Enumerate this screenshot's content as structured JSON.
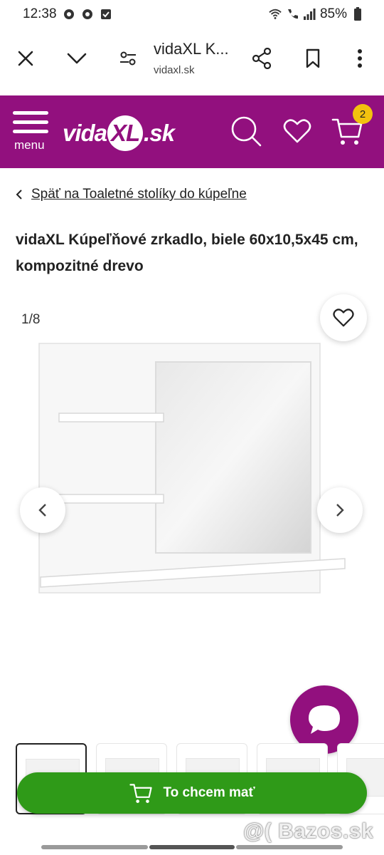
{
  "status_bar": {
    "time": "12:38",
    "battery": "85%"
  },
  "browser": {
    "title": "vidaXL K...",
    "url": "vidaxl.sk"
  },
  "header": {
    "menu_label": "menu",
    "logo_left": "vida",
    "logo_mid": "XL",
    "logo_right": ".sk",
    "cart_count": "2",
    "brand_color": "#92107e",
    "badge_color": "#f2c20f"
  },
  "breadcrumb": {
    "back_label": "Späť na Toaletné stolíky do kúpeľne"
  },
  "product": {
    "title": "vidaXL Kúpeľňové zrkadlo, biele 60x10,5x45 cm, kompozitné drevo",
    "image_counter": "1/8"
  },
  "cta": {
    "label": "To chcem mať",
    "color": "#2f9a18"
  },
  "watermark": "@( Bazos.sk"
}
